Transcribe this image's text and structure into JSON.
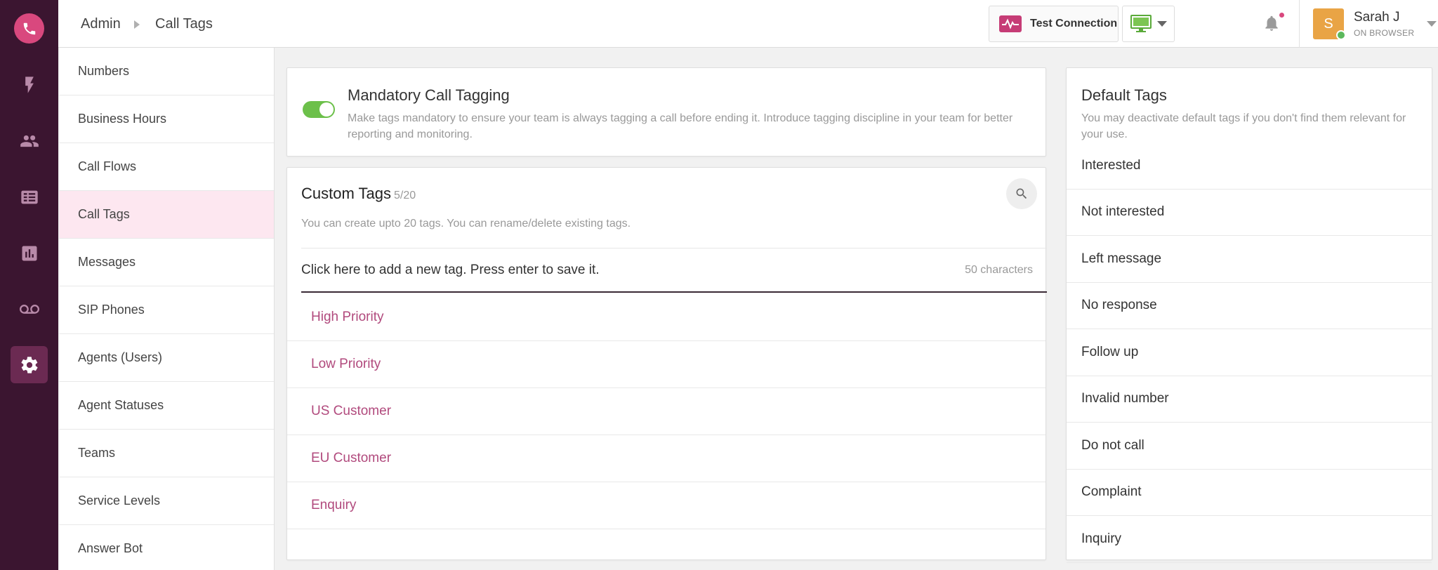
{
  "header": {
    "breadcrumb": [
      "Admin",
      "Call Tags"
    ],
    "test_connection_label": "Test Connection",
    "user": {
      "initial": "S",
      "name": "Sarah J",
      "status": "ON BROWSER"
    }
  },
  "rail": {
    "items": [
      "phone-icon",
      "bolt-icon",
      "contacts-icon",
      "id-card-icon",
      "analytics-icon",
      "voicemail-icon",
      "settings-icon"
    ],
    "active": "settings-icon"
  },
  "submenu": {
    "items": [
      "Numbers",
      "Business Hours",
      "Call Flows",
      "Call Tags",
      "Messages",
      "SIP Phones",
      "Agents (Users)",
      "Agent Statuses",
      "Teams",
      "Service Levels",
      "Answer Bot"
    ],
    "active": "Call Tags"
  },
  "mandatory": {
    "title": "Mandatory Call Tagging",
    "description": "Make tags mandatory to ensure your team is always tagging a call before ending it. Introduce tagging discipline in your team for better reporting and monitoring.",
    "enabled": true
  },
  "custom_tags": {
    "title": "Custom Tags",
    "count": "5/20",
    "description": "You can create upto 20 tags. You can rename/delete existing tags.",
    "input_placeholder": "Click here to add a new tag. Press enter to save it.",
    "char_limit": "50 characters",
    "tags": [
      "High Priority",
      "Low Priority",
      "US Customer",
      "EU Customer",
      "Enquiry"
    ]
  },
  "default_tags": {
    "title": "Default Tags",
    "description": "You may deactivate default tags if you don't find them relevant for your use.",
    "tags": [
      "Interested",
      "Not interested",
      "Left message",
      "No response",
      "Follow up",
      "Invalid number",
      "Do not call",
      "Complaint",
      "Inquiry"
    ]
  },
  "colors": {
    "rail_bg": "#3b1530",
    "accent": "#d9487e",
    "tag_text": "#b14a7d",
    "toggle_on": "#6cc04a"
  }
}
